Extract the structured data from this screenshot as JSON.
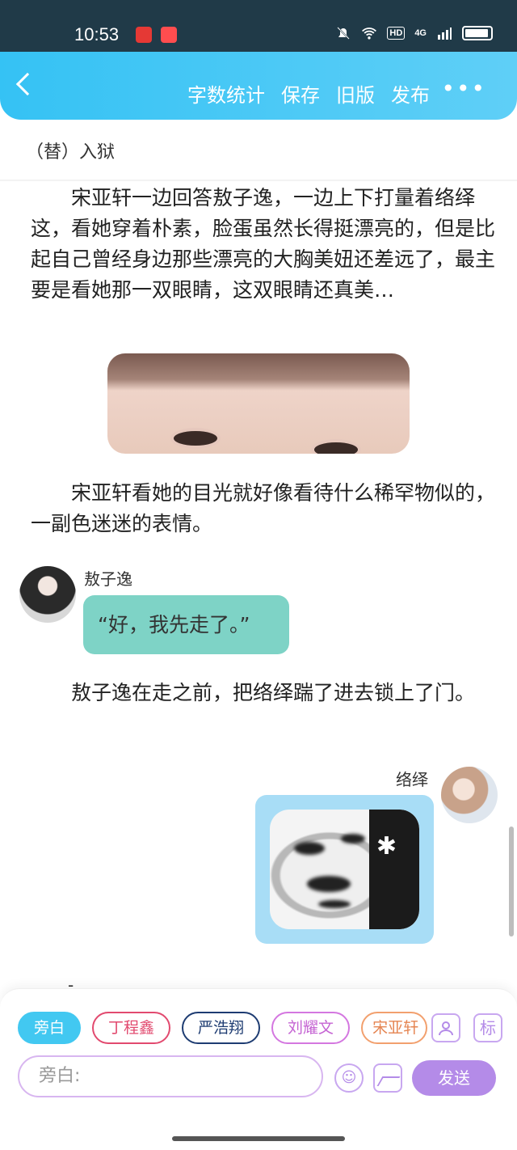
{
  "status_bar": {
    "time": "10:53",
    "hd": "HD",
    "network": "4G"
  },
  "header": {
    "actions": [
      "字数统计",
      "保存",
      "旧版",
      "发布"
    ],
    "more": "•••"
  },
  "chapter_title": "（替）入狱",
  "paragraphs": {
    "p1": "宋亚轩一边回答敖子逸，一边上下打量着络绎这，看她穿着朴素，脸蛋虽然长得挺漂亮的，但是比起自己曾经身边那些漂亮的大胸美妞还差远了，最主要是看她那一双眼睛，这双眼睛还真美…",
    "p2": "宋亚轩看她的目光就好像看待什么稀罕物似的，一副色迷迷的表情。",
    "p3": "敖子逸在走之前，把络绎踹了进去锁上了门。"
  },
  "message_left": {
    "sender": "敖子逸",
    "text": "“好，我先走了。”"
  },
  "message_right": {
    "sender": "络绎"
  },
  "dash": "-",
  "composer": {
    "chips": [
      "旁白",
      "丁程鑫",
      "严浩翔",
      "刘耀文",
      "宋亚轩"
    ],
    "biao_label": "标",
    "input_placeholder": "旁白:",
    "send_label": "发送"
  },
  "colors": {
    "header_blue": "#35c2f4",
    "teal_bubble": "#7ed3c6",
    "blue_bubble": "#a8ddf6",
    "accent_purple": "#b48be8"
  }
}
